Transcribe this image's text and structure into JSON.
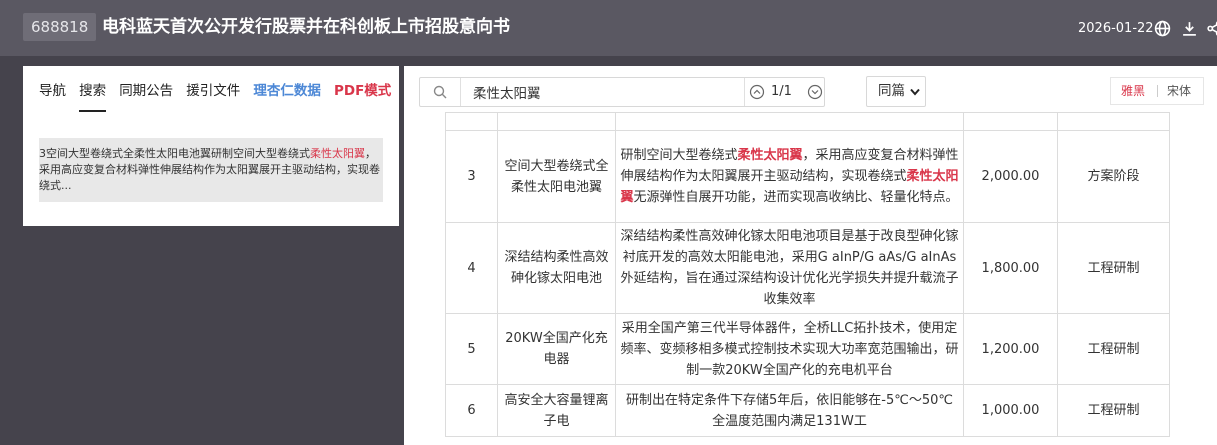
{
  "header": {
    "stock_code": "688818",
    "doc_title": "电科蓝天首次公开发行股票并在科创板上市招股意向书",
    "date": "2026-01-22",
    "icons": [
      "globe-icon",
      "download-icon",
      "share-icon"
    ]
  },
  "left": {
    "tabs": [
      {
        "label": "导航"
      },
      {
        "label": "搜索"
      },
      {
        "label": "同期公告"
      },
      {
        "label": "援引文件"
      },
      {
        "label": "理杏仁数据"
      },
      {
        "label": "PDF模式"
      }
    ],
    "result": {
      "prefix": "3空间大型卷绕式全柔性太阳电池翼研制空间大型卷绕式",
      "highlight": "柔性太阳翼",
      "suffix": "，采用高应变复合材料弹性伸展结构作为太阳翼展开主驱动结构，实现卷绕式..."
    }
  },
  "search": {
    "value": "柔性太阳翼",
    "count": "1/1",
    "scope": "同篇",
    "font_options": [
      "雅黑",
      "宋体"
    ]
  },
  "table": {
    "rows": [
      {
        "no": "3",
        "name": "空间大型卷绕式全柔性太阳电池翼",
        "content_parts": [
          {
            "t": "研制空间大型卷绕式",
            "hl": false
          },
          {
            "t": "柔性太阳翼",
            "hl": true
          },
          {
            "t": "，采用高应变复合材料弹性伸展结构作为太阳翼展开主驱动结构，实现卷绕式",
            "hl": false
          },
          {
            "t": "柔性太阳翼",
            "hl": true
          },
          {
            "t": "无源弹性自展开功能，进而实现高收纳比、轻量化特点。",
            "hl": false
          }
        ],
        "amount": "2,000.00",
        "stage": "方案阶段"
      },
      {
        "no": "4",
        "name": "深结结构柔性高效砷化镓太阳电池",
        "content_parts": [
          {
            "t": "深结结构柔性高效砷化镓太阳电池项目是基于改良型砷化镓衬底开发的高效太阳能电池，采用G aInP/G aAs/G aInAs外延结构，旨在通过深结构设计优化光学损失并提升载流子收集效率",
            "hl": false
          }
        ],
        "amount": "1,800.00",
        "stage": "工程研制"
      },
      {
        "no": "5",
        "name": "20KW全国产化充电器",
        "content_parts": [
          {
            "t": "采用全国产第三代半导体器件，全桥LLC拓扑技术，使用定频率、变频移相多模式控制技术实现大功率宽范围输出，研制一款20KW全国产化的充电机平台",
            "hl": false
          }
        ],
        "amount": "1,200.00",
        "stage": "工程研制"
      },
      {
        "no": "6",
        "name": "高安全大容量锂离子电",
        "content_parts": [
          {
            "t": "研制出在特定条件下存储5年后，依旧能够在-5℃～50℃全温度范围内满足131W工",
            "hl": false
          }
        ],
        "amount": "1,000.00",
        "stage": "工程研制"
      }
    ]
  },
  "colors": {
    "background": "#45434c",
    "topbar": "#5a5862",
    "highlight": "#d9364a",
    "link_blue": "#4d88d6"
  }
}
